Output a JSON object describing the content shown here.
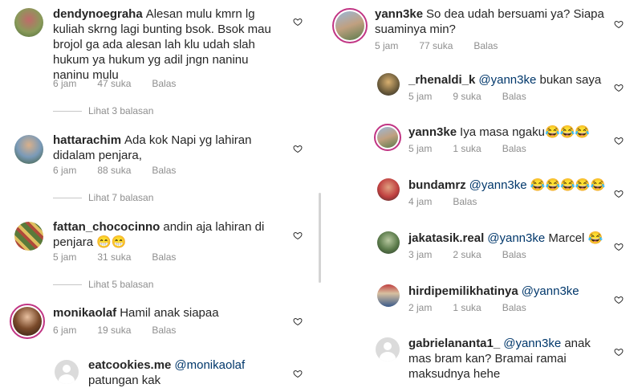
{
  "left": {
    "comments": [
      {
        "user": "dendynoegraha",
        "text": "Alesan mulu kmrn lg kuliah skrng lagi bunting bsok. Bsok mau brojol ga ada alesan lah klu udah slah hukum ya hukum yg adil jngn naninu naninu mulu",
        "time": "6 jam",
        "likes": "47 suka",
        "reply": "Balas",
        "view_replies": "Lihat 3 balasan"
      },
      {
        "user": "hattarachim",
        "text": "Ada kok Napi yg lahiran didalam penjara,",
        "time": "6 jam",
        "likes": "88 suka",
        "reply": "Balas",
        "view_replies": "Lihat 7 balasan"
      },
      {
        "user": "fattan_chococinno",
        "text": "andin aja lahiran di penjara 😁😁",
        "time": "5 jam",
        "likes": "31 suka",
        "reply": "Balas",
        "view_replies": "Lihat 5 balasan"
      },
      {
        "user": "monikaolaf",
        "text": "Hamil anak siapaa",
        "time": "6 jam",
        "likes": "19 suka",
        "reply": "Balas"
      },
      {
        "user": "eatcookies.me",
        "mention": "@monikaolaf",
        "text": "patungan kak"
      }
    ]
  },
  "right": {
    "main": {
      "user": "yann3ke",
      "text": "So dea udah bersuami ya? Siapa suaminya min?",
      "time": "5 jam",
      "likes": "77 suka",
      "reply": "Balas"
    },
    "replies": [
      {
        "user": "_rhenaldi_k",
        "mention": "@yann3ke",
        "text": "bukan saya",
        "time": "5 jam",
        "likes": "9 suka",
        "reply": "Balas"
      },
      {
        "user": "yann3ke",
        "mention": "",
        "text": "Iya masa ngaku😂😂😂",
        "time": "5 jam",
        "likes": "1 suka",
        "reply": "Balas"
      },
      {
        "user": "bundamrz",
        "mention": "@yann3ke",
        "text": "😂😂😂😂😂",
        "time": "4 jam",
        "likes": "",
        "reply": "Balas"
      },
      {
        "user": "jakatasik.real",
        "mention": "@yann3ke",
        "text": "Marcel 😂",
        "time": "3 jam",
        "likes": "2 suka",
        "reply": "Balas"
      },
      {
        "user": "hirdipemilikhatinya",
        "mention": "@yann3ke",
        "text": "",
        "time": "2 jam",
        "likes": "1 suka",
        "reply": "Balas"
      },
      {
        "user": "gabrielananta1_",
        "mention": "@yann3ke",
        "text": "anak mas bram kan? Bramai ramai maksudnya hehe",
        "time": "",
        "likes": "",
        "reply": ""
      }
    ]
  },
  "colors": {
    "mention": "#00376b",
    "meta": "#8e8e8e",
    "ring": "#c13584"
  },
  "icons": {
    "like": "heart-outline-icon"
  }
}
